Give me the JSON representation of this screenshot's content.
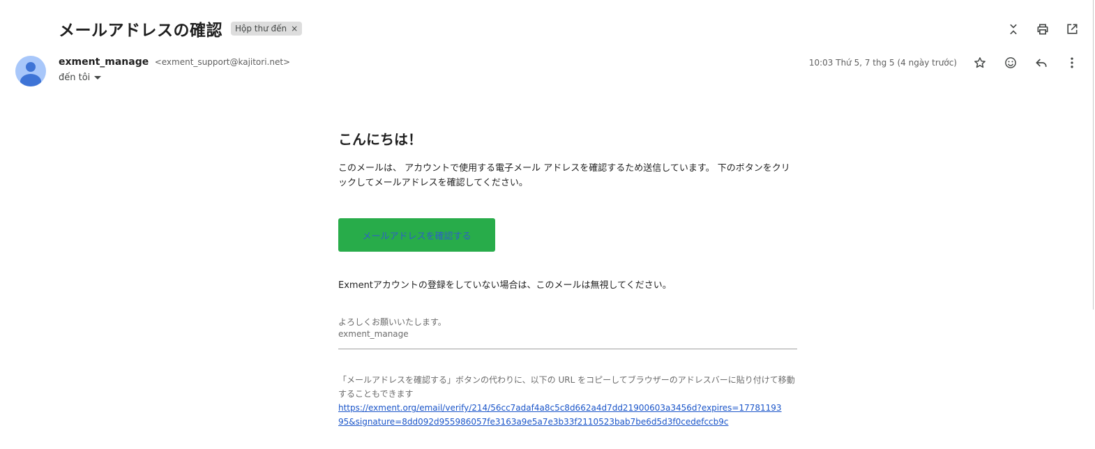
{
  "email": {
    "subject": "メールアドレスの確認",
    "label_chip": "Hộp thư đến",
    "label_chip_close": "×",
    "sender_name": "exment_manage",
    "sender_email": "<exment_support@kajitori.net>",
    "recipient": "đến tôi",
    "date": "10:03 Thứ 5, 7 thg 5 (4 ngày trước)"
  },
  "icons": {
    "top_actions": [
      "collapse-icon",
      "print-icon",
      "open-in-new-window-icon"
    ],
    "meta_actions": [
      "star-icon",
      "emoji-icon",
      "reply-icon",
      "more-vert-icon"
    ]
  },
  "body": {
    "greeting": "こんにちは！",
    "intro": "このメールは、 アカウントで使用する電子メール アドレスを確認するため送信しています。 下のボタンをクリックしてメールアドレスを確認してください。",
    "button_label": "メールアドレスを確認する",
    "ignore_text": "Exmentアカウントの登録をしていない場合は、このメールは無視してください。",
    "regards": "よろしくお願いいたします。",
    "signature": "exment_manage",
    "note": "「メールアドレスを確認する」ボタンの代わりに、以下の URL をコピーしてブラウザーのアドレスバーに貼り付けて移動することもできます",
    "link": "https://exment.org/email/verify/214/56cc7adaf4a8c5c8d662a4d7dd21900603a3456d?expires=1778119395&signature=8dd092d955986057fe3163a9e5a7e3b33f2110523bab7be6d5d3f0cedefccb9c"
  },
  "colors": {
    "button": "#28ac4a",
    "button_text": "#2f5fc7",
    "link": "#1a55c9",
    "avatar_bg": "#a8c7fa",
    "avatar_fg": "#3e74d6"
  }
}
